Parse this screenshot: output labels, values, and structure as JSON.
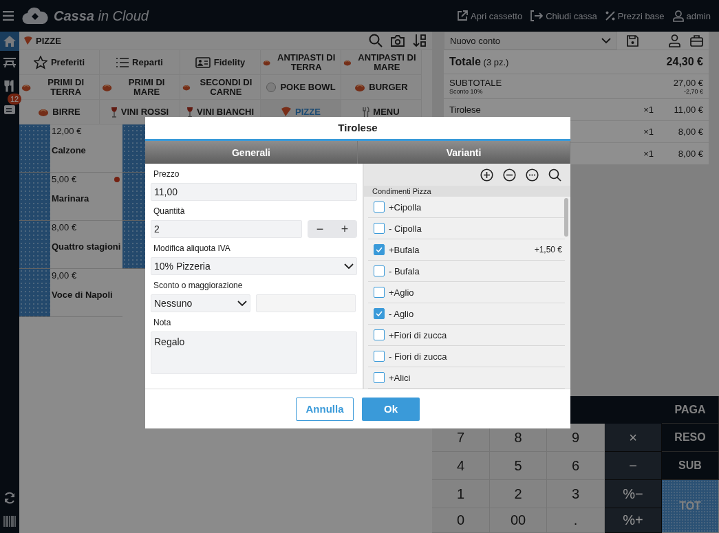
{
  "app": {
    "logo_bold": "Cassa",
    "logo_light": "in Cloud"
  },
  "top_actions": [
    {
      "kind": "external",
      "label": "Apri cassetto"
    },
    {
      "kind": "exit",
      "label": "Chiudi cassa"
    },
    {
      "kind": "percent",
      "label": "Prezzi base"
    },
    {
      "kind": "user",
      "label": "admin"
    }
  ],
  "sidebar": {
    "items": [
      {
        "kind": "home",
        "selected": true
      },
      {
        "kind": "table",
        "selected": false
      },
      {
        "kind": "cutlery",
        "selected": false
      },
      {
        "kind": "receipt",
        "selected": false,
        "badge": "12"
      }
    ],
    "bottom": [
      {
        "kind": "sync"
      },
      {
        "kind": "barcode"
      }
    ]
  },
  "category_header": {
    "title": "PIZZE"
  },
  "categories": [
    {
      "label": "Preferiti",
      "kind": "star",
      "selected": false
    },
    {
      "label": "Reparti",
      "kind": "list",
      "selected": false
    },
    {
      "label": "Fidelity",
      "kind": "card",
      "selected": false
    },
    {
      "label": "ANTIPASTI DI TERRA",
      "kind": "food",
      "selected": false
    },
    {
      "label": "ANTIPASTI DI MARE",
      "kind": "food",
      "selected": false
    },
    {
      "label": "PRIMI DI TERRA",
      "kind": "food",
      "selected": false
    },
    {
      "label": "PRIMI DI MARE",
      "kind": "food",
      "selected": false
    },
    {
      "label": "SECONDI DI CARNE",
      "kind": "food",
      "selected": false
    },
    {
      "label": "POKE BOWL",
      "kind": "bowl",
      "selected": false
    },
    {
      "label": "BURGER",
      "kind": "food",
      "selected": false
    },
    {
      "label": "BIRRE",
      "kind": "food",
      "selected": false
    },
    {
      "label": "VINI ROSSI",
      "kind": "wine",
      "selected": false
    },
    {
      "label": "VINI BIANCHI",
      "kind": "wine",
      "selected": false
    },
    {
      "label": "PIZZE",
      "kind": "pizza",
      "selected": true
    },
    {
      "label": "MENU",
      "kind": "cutlery",
      "selected": false
    }
  ],
  "products": [
    {
      "price": "12,00 €",
      "name": "Calzone",
      "flagged": false
    },
    {
      "price": "5,00 €",
      "name": "Marinara",
      "flagged": true
    },
    {
      "price": "8,00 €",
      "name": "Quattro stagioni",
      "flagged": false
    },
    {
      "price": "9,00 €",
      "name": "Voce di Napoli",
      "flagged": false
    }
  ],
  "ticket": {
    "account": "Nuovo conto",
    "total_label": "Totale",
    "total_count": "(3 pz.)",
    "total": "24,30 €",
    "subtotal_label": "SUBTOTALE",
    "subtotal": "27,00 €",
    "discount_label": "Sconto 10%",
    "discount": "-2,70 €",
    "lines": [
      {
        "name": "Tirolese",
        "qty": "×1",
        "price": "11,00 €"
      },
      {
        "qty": "×1",
        "price": "8,00 €"
      },
      {
        "qty": "×1",
        "price": "8,00 €"
      }
    ]
  },
  "keypad": {
    "keys": [
      {
        "label": "PAGA",
        "kind": "action"
      },
      {
        "label": "7",
        "kind": "digit"
      },
      {
        "label": "8",
        "kind": "digit"
      },
      {
        "label": "9",
        "kind": "digit"
      },
      {
        "label": "×",
        "kind": "op"
      },
      {
        "label": "RESO",
        "kind": "action"
      },
      {
        "label": "4",
        "kind": "digit"
      },
      {
        "label": "5",
        "kind": "digit"
      },
      {
        "label": "6",
        "kind": "digit"
      },
      {
        "label": "−",
        "kind": "op"
      },
      {
        "label": "SUB",
        "kind": "action"
      },
      {
        "label": "1",
        "kind": "digit"
      },
      {
        "label": "2",
        "kind": "digit"
      },
      {
        "label": "3",
        "kind": "digit"
      },
      {
        "label": "%−",
        "kind": "op"
      },
      {
        "label": "TOT",
        "kind": "total"
      },
      {
        "label": "0",
        "kind": "digit"
      },
      {
        "label": "00",
        "kind": "digit"
      },
      {
        "label": ".",
        "kind": "digit"
      },
      {
        "label": "%+",
        "kind": "op"
      }
    ]
  },
  "dialog": {
    "title": "Tirolese",
    "tabs": [
      {
        "label": "Generali"
      },
      {
        "label": "Varianti"
      }
    ],
    "form": {
      "price_label": "Prezzo",
      "price": "11,00",
      "qty_label": "Quantità",
      "qty": "2",
      "minus": "−",
      "plus": "+",
      "vat_label": "Modifica aliquota IVA",
      "vat": "10% Pizzeria",
      "discount_label": "Sconto o maggiorazione",
      "discount_type": "Nessuno",
      "note_label": "Nota",
      "note": "Regalo"
    },
    "variants": {
      "group": "Condimenti Pizza",
      "items": [
        {
          "label": "+Cipolla",
          "checked": false
        },
        {
          "label": "- Cipolla",
          "checked": false
        },
        {
          "label": "+Bufala",
          "checked": true,
          "price": "+1,50 €"
        },
        {
          "label": "- Bufala",
          "checked": false
        },
        {
          "label": "+Aglio",
          "checked": false
        },
        {
          "label": "- Aglio",
          "checked": true
        },
        {
          "label": "+Fiori di zucca",
          "checked": false
        },
        {
          "label": "- Fiori di zucca",
          "checked": false
        },
        {
          "label": "+Alici",
          "checked": false
        }
      ]
    },
    "buttons": {
      "cancel": "Annulla",
      "ok": "Ok"
    }
  }
}
